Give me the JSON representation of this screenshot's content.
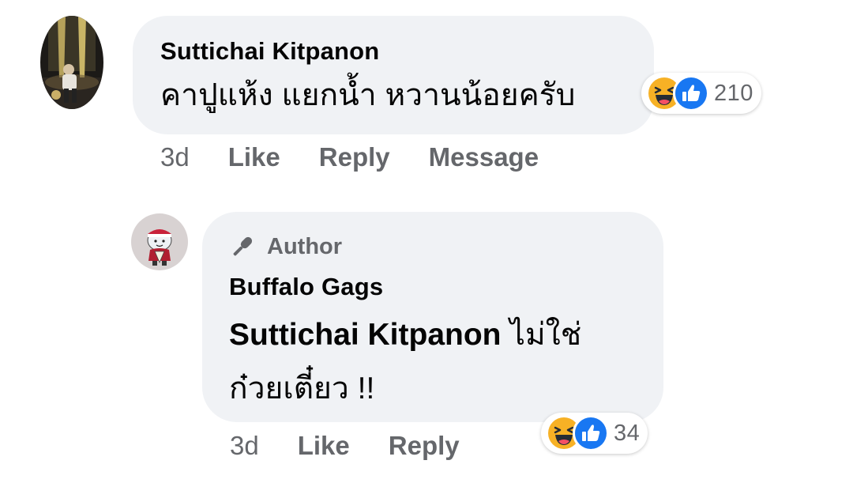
{
  "comment": {
    "author": "Suttichai Kitpanon",
    "text": "คาปูแห้ง แยกน้ำ หวานน้อยครับ",
    "reactions": {
      "icons": [
        "haha-icon",
        "like-icon"
      ],
      "count": "210"
    },
    "actions": {
      "time": "3d",
      "like": "Like",
      "reply": "Reply",
      "message": "Message"
    }
  },
  "reply": {
    "badge": "Author",
    "author": "Buffalo Gags",
    "mention": "Suttichai Kitpanon",
    "text": " ไม่ใช่ ก๋วยเตี๋ยว !!",
    "reactions": {
      "icons": [
        "haha-icon",
        "like-icon"
      ],
      "count": "34"
    },
    "actions": {
      "time": "3d",
      "like": "Like",
      "reply": "Reply"
    }
  },
  "colors": {
    "bubble": "#f0f2f5",
    "secondary_text": "#65676b",
    "like_blue": "#1877f2",
    "haha_yellow": "#f7b125"
  }
}
